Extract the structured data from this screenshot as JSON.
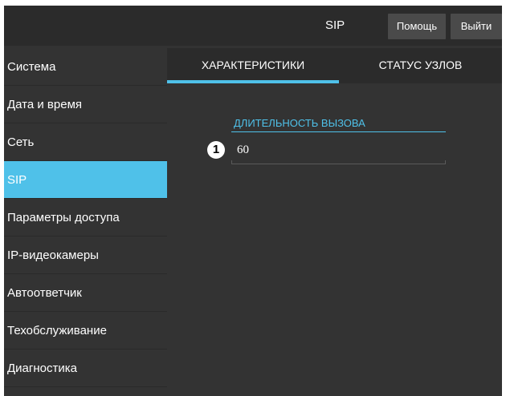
{
  "header": {
    "title": "SIP",
    "help_label": "Помощь",
    "exit_label": "Выйти"
  },
  "sidebar": {
    "items": [
      {
        "label": "Система",
        "active": false
      },
      {
        "label": "Дата и время",
        "active": false
      },
      {
        "label": "Сеть",
        "active": false
      },
      {
        "label": "SIP",
        "active": true
      },
      {
        "label": "Параметры доступа",
        "active": false
      },
      {
        "label": "IP-видеокамеры",
        "active": false
      },
      {
        "label": "Автоответчик",
        "active": false
      },
      {
        "label": "Техобслуживание",
        "active": false
      },
      {
        "label": "Диагностика",
        "active": false
      }
    ]
  },
  "tabs": [
    {
      "label": "ХАРАКТЕРИСТИКИ",
      "active": true
    },
    {
      "label": "СТАТУС УЗЛОВ",
      "active": false
    }
  ],
  "form": {
    "call_duration_label": "ДЛИТЕЛЬНОСТЬ ВЫЗОВА",
    "call_duration_value": "60",
    "marker": "1"
  },
  "colors": {
    "accent": "#4fc1e9",
    "background": "#333333",
    "topbar": "#2b2b2b",
    "button": "#4a4a4a"
  }
}
